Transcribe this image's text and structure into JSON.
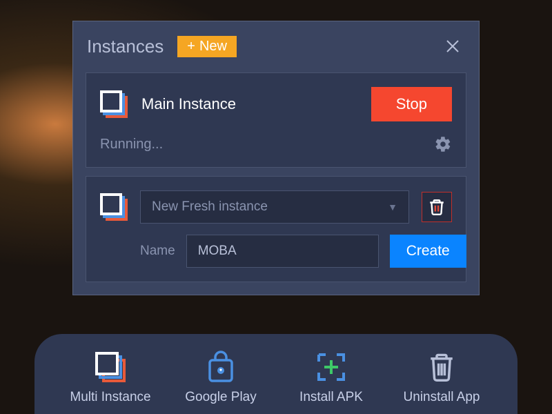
{
  "dialog": {
    "title": "Instances",
    "new_button": "New",
    "instance": {
      "name": "Main Instance",
      "stop_label": "Stop",
      "status": "Running..."
    },
    "create": {
      "dropdown_selected": "New Fresh instance",
      "name_label": "Name",
      "name_value": "MOBA",
      "create_label": "Create"
    }
  },
  "bottombar": {
    "multi_instance": "Multi Instance",
    "google_play": "Google Play",
    "install_apk": "Install APK",
    "uninstall_app": "Uninstall App"
  }
}
